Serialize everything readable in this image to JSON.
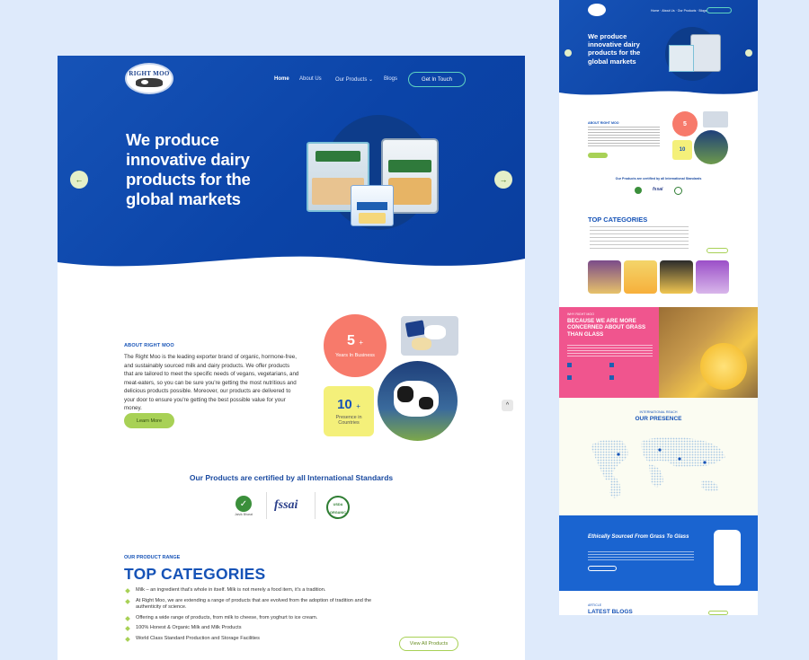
{
  "brand": {
    "logo_text": "RIGHT MOO"
  },
  "nav": {
    "items": [
      "Home",
      "About Us",
      "Our Products",
      "Blogs"
    ],
    "cta": "Get In Touch"
  },
  "hero": {
    "title": "We produce innovative dairy products for the global markets"
  },
  "about": {
    "label": "ABOUT RIGHT MOO",
    "text": "The Right Moo is the leading exporter brand of organic, hormone-free, and sustainably sourced milk and dairy products. We offer products that are tailored to meet the specific needs of vegans, vegetarians, and meat-eaters, so you can be sure you're getting the most nutritious and delicious products possible. Moreover, our products are delivered to your door to ensure you're getting the best possible value for your money.",
    "button": "Learn More",
    "stat1": {
      "value": "5",
      "suffix": "+",
      "label": "Years In Business"
    },
    "stat2": {
      "value": "10",
      "suffix": "+",
      "label": "Presence in Countries"
    }
  },
  "certs": {
    "title": "Our Products are certified by all International Standards",
    "items": [
      "Jaivik Bharat",
      "fssai",
      "USDA ORGANIC"
    ]
  },
  "categories": {
    "label": "OUR PRODUCT RANGE",
    "title": "TOP CATEGORIES",
    "bullets": [
      "Milk – an ingredient that's whole in itself. Milk is not merely a food item, it's a tradition.",
      "At Right Moo, we are extending a range of products that are evolved from the adoption of tradition and the authenticity of science.",
      "Offering a wide range of products, from milk to cheese, from yoghurt to ice cream.",
      "100% Honest & Organic Milk and Milk Products",
      "World Class Standard Production and Storage Facilities"
    ],
    "button": "View All Products"
  },
  "mini": {
    "hero_title": "We produce innovative dairy products for the global markets",
    "about_label": "ABOUT RIGHT MOO",
    "cert_title": "Our Products are certified by all International Standards",
    "cat_title": "TOP CATEGORIES",
    "grass_label": "WHY RIGHT MOO",
    "grass_title": "BECAUSE WE ARE MORE CONCERNED ABOUT GRASS THAN GLASS",
    "presence_label": "INTERNATIONAL REACH",
    "presence_title": "OUR PRESENCE",
    "ethic_title": "Ethically Sourced From Grass To Glass",
    "blogs_label": "ARTICLE",
    "blogs_title": "LATEST BLOGS"
  },
  "colors": {
    "primary": "#1653b7",
    "accent_green": "#a8d156",
    "stat_pink": "#f77a6b",
    "stat_yellow": "#f4f07a",
    "pink": "#f0558e"
  }
}
